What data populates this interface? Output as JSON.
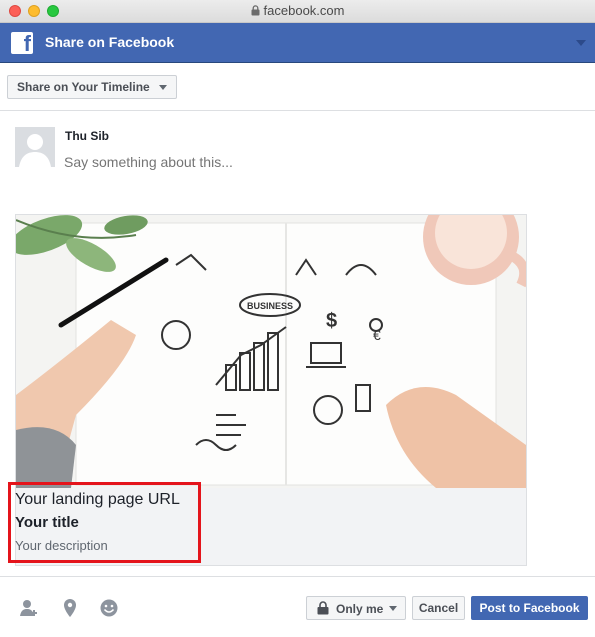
{
  "window": {
    "url": "facebook.com"
  },
  "header": {
    "title": "Share on Facebook",
    "logo_letter": "f"
  },
  "share_target": {
    "selected": "Share on Your Timeline"
  },
  "composer": {
    "user_name": "Thu Sib",
    "placeholder": "Say something about this..."
  },
  "link_preview": {
    "url": "Your landing page URL",
    "title": "Your title",
    "description": "Your description",
    "image_label": "BUSINESS"
  },
  "footer": {
    "privacy_label": "Only me",
    "cancel_label": "Cancel",
    "post_label": "Post to Facebook",
    "icons": [
      "tag-friends-icon",
      "location-pin-icon",
      "feeling-smiley-icon"
    ]
  },
  "colors": {
    "brand_blue": "#4267b2",
    "highlight_red": "#e4141b"
  }
}
